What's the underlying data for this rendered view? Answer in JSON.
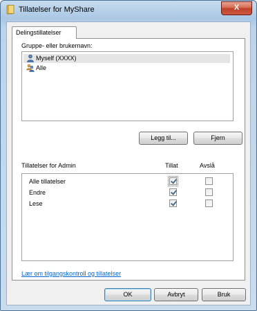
{
  "window": {
    "title": "Tillatelser for MyShare",
    "close_label": "X"
  },
  "tab": {
    "label": "Delingstillatelser"
  },
  "group_section": {
    "label": "Gruppe- eller brukernavn:",
    "items": [
      {
        "name": "Myself (XXXX)",
        "icon": "user-icon",
        "selected": true
      },
      {
        "name": "Alle",
        "icon": "group-icon",
        "selected": false
      }
    ],
    "add_button": "Legg til...",
    "remove_button": "Fjern"
  },
  "permissions": {
    "header": "Tillatelser for Admin",
    "allow_header": "Tillat",
    "deny_header": "Avslå",
    "rows": [
      {
        "name": "Alle tillatelser",
        "allow": true,
        "deny": false
      },
      {
        "name": "Endre",
        "allow": true,
        "deny": false
      },
      {
        "name": "Lese",
        "allow": true,
        "deny": false
      }
    ]
  },
  "help_link": "Lær om tilgangskontroll og tillatelser",
  "buttons": {
    "ok": "OK",
    "cancel": "Avbryt",
    "apply": "Bruk"
  },
  "colors": {
    "titlebar": "#aac7e4",
    "close_button": "#c9583e",
    "link": "#0066cc"
  }
}
